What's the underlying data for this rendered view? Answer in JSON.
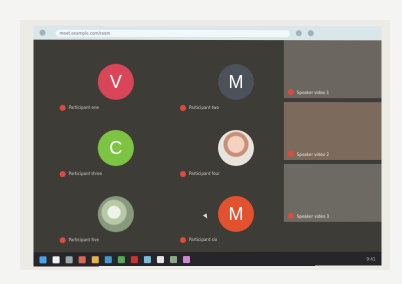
{
  "browser": {
    "url": "meet.example.com/room"
  },
  "participants": [
    {
      "initial": "V",
      "color": "#d9465a",
      "name": "Participant one",
      "style": "letter"
    },
    {
      "initial": "M",
      "color": "#4c5259",
      "name": "Participant two",
      "style": "letter"
    },
    {
      "initial": "C",
      "color": "#7cc442",
      "name": "Participant three",
      "style": "letter"
    },
    {
      "initial": "",
      "color": "#e7e4dd",
      "name": "Participant four",
      "style": "photo"
    },
    {
      "initial": "",
      "color": "#b7c9a7",
      "name": "Participant five",
      "style": "globe"
    },
    {
      "initial": "M",
      "color": "#e4512f",
      "name": "Participant six",
      "style": "letter"
    }
  ],
  "videos": [
    {
      "name": "Speaker video 1",
      "bg": "#6b6660"
    },
    {
      "name": "Speaker video 2",
      "bg": "#7c6a5c"
    },
    {
      "name": "Speaker video 3",
      "bg": "#6d6a63"
    }
  ],
  "taskbar": {
    "icons": [
      "#4aa3e8",
      "#f0f0f0",
      "#9aa",
      "#d65",
      "#e7b14a",
      "#49c",
      "#5a5",
      "#c33",
      "#7bd",
      "#e6e6e6",
      "#8a8",
      "#c8c"
    ],
    "tray": "9:41"
  }
}
